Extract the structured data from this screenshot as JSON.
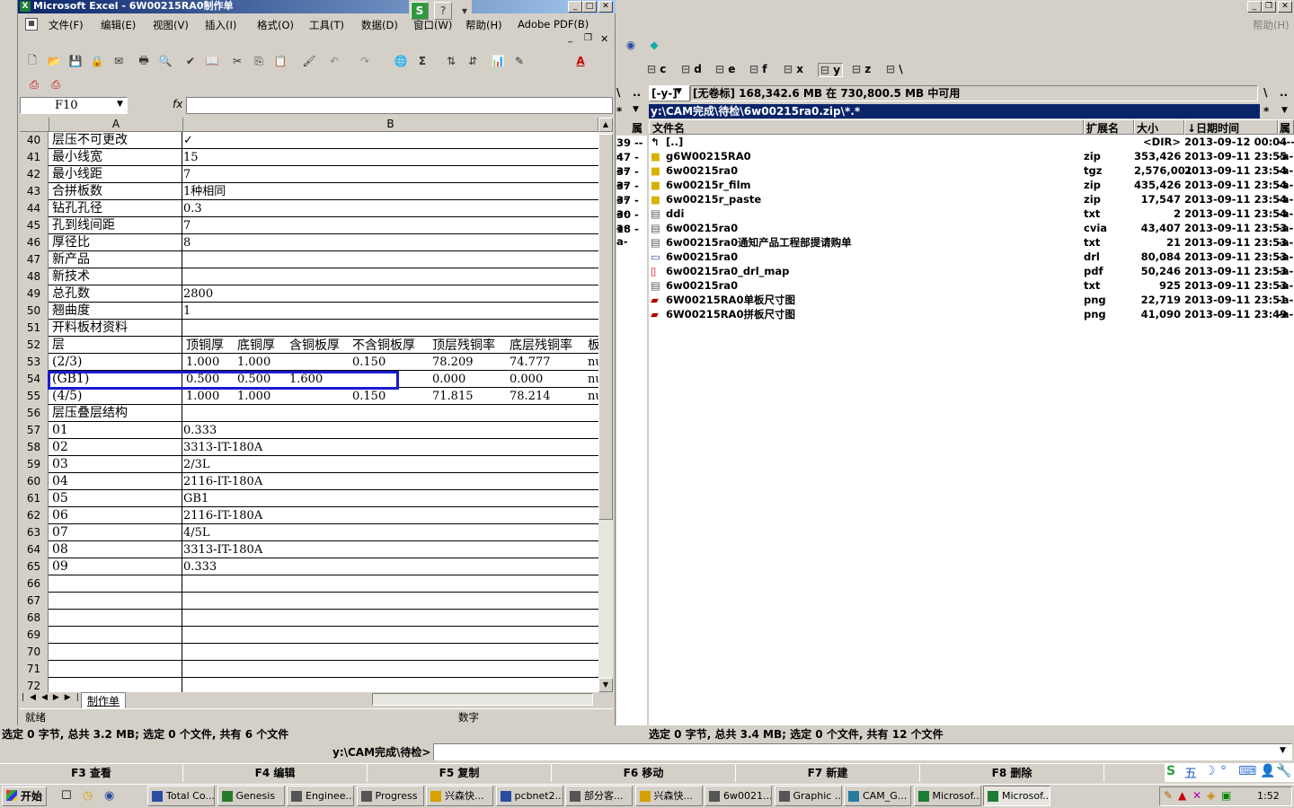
{
  "excel": {
    "title": "Microsoft Excel - 6W00215RA0制作单",
    "menus": [
      "文件(F)",
      "编辑(E)",
      "视图(V)",
      "插入(I)",
      "格式(O)",
      "工具(T)",
      "数据(D)",
      "窗口(W)",
      "帮助(H)",
      "Adobe PDF(B)"
    ],
    "name_box": "F10",
    "fx_label": "fx",
    "col_a": "A",
    "col_b": "B",
    "rows": [
      {
        "n": "40",
        "a": "层压不可更改",
        "b": "✓"
      },
      {
        "n": "41",
        "a": "最小线宽",
        "b": "15"
      },
      {
        "n": "42",
        "a": "最小线距",
        "b": "7"
      },
      {
        "n": "43",
        "a": "合拼板数",
        "b": "1种相同"
      },
      {
        "n": "44",
        "a": "钻孔孔径",
        "b": "0.3"
      },
      {
        "n": "45",
        "a": "孔到线间距",
        "b": "7"
      },
      {
        "n": "46",
        "a": "厚径比",
        "b": "8"
      },
      {
        "n": "47",
        "a": "新产品",
        "b": ""
      },
      {
        "n": "48",
        "a": "新技术",
        "b": ""
      },
      {
        "n": "49",
        "a": "总孔数",
        "b": "2800"
      },
      {
        "n": "50",
        "a": "翘曲度",
        "b": "1"
      },
      {
        "n": "51",
        "a": "开料板材资料",
        "b": ""
      },
      {
        "n": "52",
        "a": "层",
        "b": "",
        "multi": [
          "顶铜厚",
          "底铜厚",
          "含铜板厚",
          "不含铜板厚",
          "顶层残铜率",
          "底层残铜率",
          "板"
        ]
      },
      {
        "n": "53",
        "a": "(2/3)",
        "b": "",
        "multi": [
          "1.000",
          "1.000",
          "",
          "0.150",
          "78.209",
          "74.777",
          "nu"
        ]
      },
      {
        "n": "54",
        "a": "(GB1)",
        "b": "",
        "multi": [
          "0.500",
          "0.500",
          "1.600",
          "",
          "0.000",
          "0.000",
          "nu"
        ]
      },
      {
        "n": "55",
        "a": "(4/5)",
        "b": "",
        "multi": [
          "1.000",
          "1.000",
          "",
          "0.150",
          "71.815",
          "78.214",
          "nu"
        ]
      },
      {
        "n": "56",
        "a": "层压叠层结构",
        "b": ""
      },
      {
        "n": "57",
        "a": "01",
        "b": "0.333"
      },
      {
        "n": "58",
        "a": "02",
        "b": "3313-IT-180A"
      },
      {
        "n": "59",
        "a": "03",
        "b": "2/3L"
      },
      {
        "n": "60",
        "a": "04",
        "b": "2116-IT-180A"
      },
      {
        "n": "61",
        "a": "05",
        "b": "GB1"
      },
      {
        "n": "62",
        "a": "06",
        "b": "2116-IT-180A"
      },
      {
        "n": "63",
        "a": "07",
        "b": "4/5L"
      },
      {
        "n": "64",
        "a": "08",
        "b": "3313-IT-180A"
      },
      {
        "n": "65",
        "a": "09",
        "b": "0.333"
      },
      {
        "n": "66",
        "a": "",
        "b": ""
      },
      {
        "n": "67",
        "a": "",
        "b": ""
      },
      {
        "n": "68",
        "a": "",
        "b": ""
      },
      {
        "n": "69",
        "a": "",
        "b": ""
      },
      {
        "n": "70",
        "a": "",
        "b": ""
      },
      {
        "n": "71",
        "a": "",
        "b": ""
      },
      {
        "n": "72",
        "a": "",
        "b": ""
      }
    ],
    "sheet_tab": "制作单",
    "status_ready": "就绪",
    "status_num": "数字"
  },
  "tc": {
    "help": "帮助(H)",
    "drives": [
      "c",
      "d",
      "e",
      "f",
      "x",
      "y",
      "z",
      "\\"
    ],
    "drive_select": "[-y-]",
    "drive_info": "[无卷标] 168,342.6 MB 在 730,800.5 MB 中可用",
    "path": "y:\\CAM完成\\待检\\6w00215ra0.zip\\*.*",
    "path_star": "*",
    "col_name": "文件名",
    "col_ext": "扩展名",
    "col_size": "大小",
    "col_date": "↓日期时间",
    "col_attr": "属",
    "files": [
      {
        "name": "[..]",
        "ext": "",
        "size": "<DIR>",
        "date": "2013-09-12 00:04",
        "attr": "----"
      },
      {
        "name": "g6W00215RA0",
        "ext": "zip",
        "size": "353,426",
        "date": "2013-09-11 23:55",
        "attr": "-a-"
      },
      {
        "name": "6w00215ra0",
        "ext": "tgz",
        "size": "2,576,001",
        "date": "2013-09-11 23:54",
        "attr": "-a-"
      },
      {
        "name": "6w00215r_film",
        "ext": "zip",
        "size": "435,426",
        "date": "2013-09-11 23:54",
        "attr": "-a-"
      },
      {
        "name": "6w00215r_paste",
        "ext": "zip",
        "size": "17,547",
        "date": "2013-09-11 23:54",
        "attr": "-a-"
      },
      {
        "name": "ddi",
        "ext": "txt",
        "size": "2",
        "date": "2013-09-11 23:54",
        "attr": "-a-"
      },
      {
        "name": "6w00215ra0",
        "ext": "cvia",
        "size": "43,407",
        "date": "2013-09-11 23:53",
        "attr": "-a-"
      },
      {
        "name": "6w00215ra0通知产品工程部提请购单",
        "ext": "txt",
        "size": "21",
        "date": "2013-09-11 23:53",
        "attr": "-a-"
      },
      {
        "name": "6w00215ra0",
        "ext": "drl",
        "size": "80,084",
        "date": "2013-09-11 23:53",
        "attr": "-a-"
      },
      {
        "name": "6w00215ra0_drl_map",
        "ext": "pdf",
        "size": "50,246",
        "date": "2013-09-11 23:53",
        "attr": "-a-"
      },
      {
        "name": "6w00215ra0",
        "ext": "txt",
        "size": "925",
        "date": "2013-09-11 23:53",
        "attr": "-a-"
      },
      {
        "name": "6W00215RA0单板尺寸图",
        "ext": "png",
        "size": "22,719",
        "date": "2013-09-11 23:51",
        "attr": "-a-"
      },
      {
        "name": "6W00215RA0拼板尺寸图",
        "ext": "png",
        "size": "41,090",
        "date": "2013-09-11 23:49",
        "attr": "-a-"
      }
    ],
    "left_attrs": [
      "39 ---",
      "47 -a-",
      "37 -a-",
      "37 -a-",
      "37 -a-",
      "30 -a-",
      "18 -a-"
    ],
    "left_status": "选定 0 字节, 总共 3.2 MB; 选定 0 个文件, 共有 6 个文件",
    "right_status": "选定 0 字节, 总共 3.4 MB; 选定 0 个文件, 共有 12 个文件",
    "cmd_path": "y:\\CAM完成\\待检>",
    "fkeys": [
      "F3 查看",
      "F4 编辑",
      "F5 复制",
      "F6 移动",
      "F7 新建",
      "F8 删除"
    ]
  },
  "taskbar": {
    "start": "开始",
    "tasks": [
      "Total Co...",
      "Genesis",
      "Enginee...",
      "Progress",
      "兴森快...",
      "pcbnet2...",
      "部分客...",
      "兴森快...",
      "6w0021...",
      "Graphic ...",
      "CAM_G...",
      "Microsof...",
      "Microsof..."
    ],
    "clock": "1:52",
    "ime": "五"
  }
}
